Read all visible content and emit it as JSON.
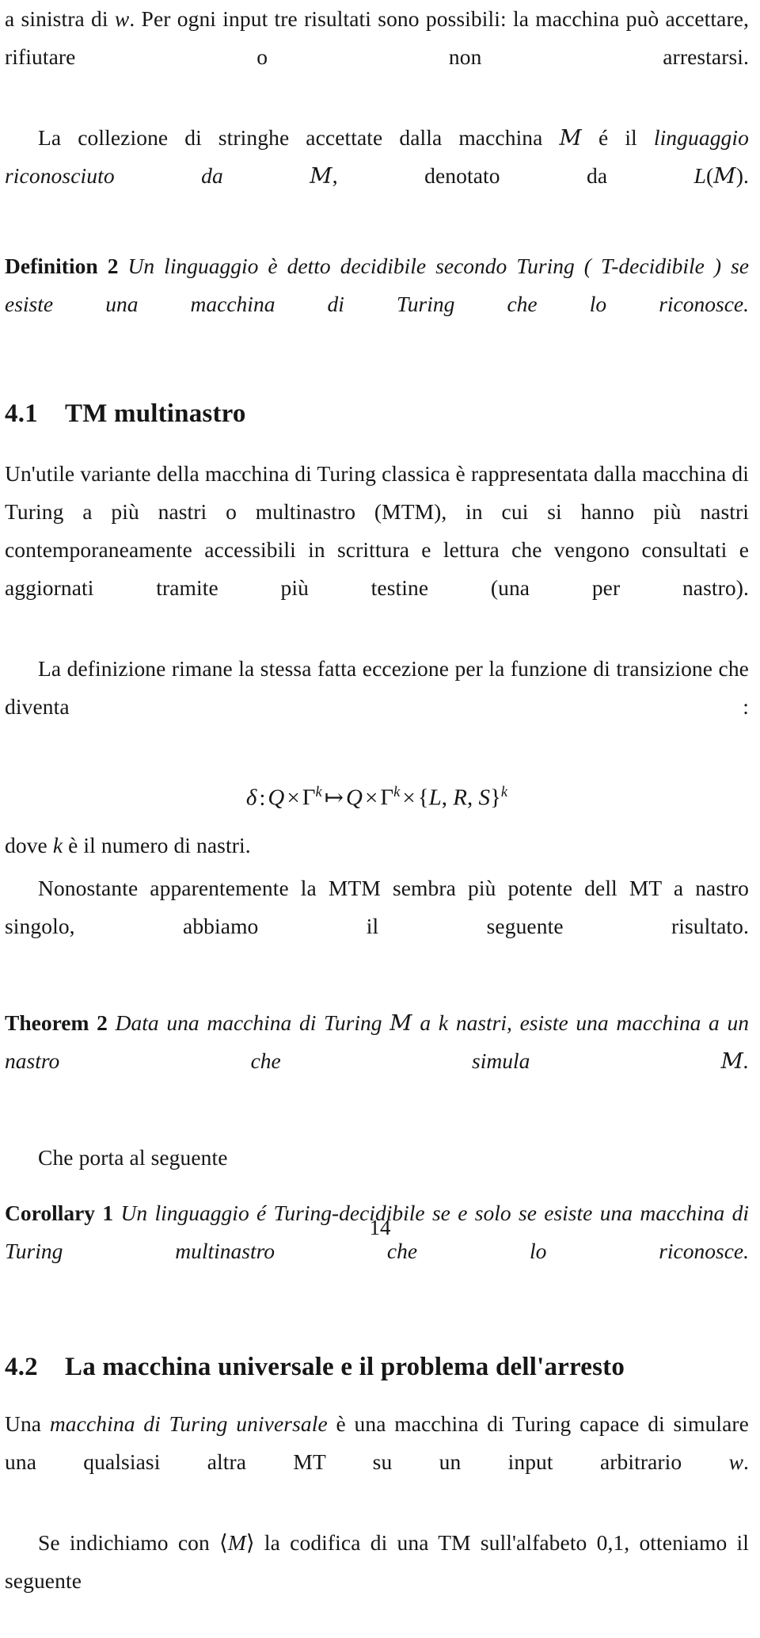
{
  "document": {
    "language": "it",
    "page_number": "14"
  },
  "blocks": {
    "para_results": {
      "t1": "a sinistra di ",
      "var_w": "w",
      "t2": ". Per ogni input tre risultati sono possibili: la macchina può accettare, rifiutare o non arrestarsi."
    },
    "para_language": {
      "t1": "La collezione di stringhe accettate dalla macchina ",
      "cal_M": "M",
      "t2": " é il ",
      "em1": "linguaggio riconosciuto da ",
      "cal_M2": "M",
      "t3": ", denotato da ",
      "var_L": "L",
      "t4": "(",
      "cal_M3": "M",
      "t5": ")."
    },
    "definition2": {
      "head": "Definition 2",
      "body": "Un linguaggio è detto decidibile secondo Turing ( T-decidibile ) se esiste una macchina di Turing che lo riconosce."
    },
    "section_41": {
      "number": "4.1",
      "title": "TM multinastro"
    },
    "para_mtm": {
      "text": "Un'utile variante della macchina di Turing classica è rappresentata dalla macchina di Turing a più nastri o multinastro (MTM), in cui si hanno più nastri contemporaneamente accessibili in scrittura e lettura che vengono consultati e aggiornati tramite più testine (una per nastro)."
    },
    "para_definizione": {
      "text": "La definizione rimane la stessa fatta eccezione per la funzione di transizione che diventa :"
    },
    "equation_delta": {
      "delta": "δ",
      "colon": ":",
      "Q1": "Q",
      "times1": "×",
      "Gamma1": "Γ",
      "exp1": "k",
      "mapsto": "↦",
      "Q2": "Q",
      "times2": "×",
      "Gamma2": "Γ",
      "exp2": "k",
      "times3": "×",
      "set_open": "{",
      "set_L": "L",
      "comma1": ",",
      "set_R": "R",
      "comma2": ",",
      "set_S": "S",
      "set_close": "}",
      "exp3": "k",
      "plain": "δ : Q × Γ^k ↦ Q × Γ^k × {L, R, S}^k"
    },
    "para_dove": {
      "t1": "dove ",
      "var_k": "k",
      "t2": " è il numero di nastri."
    },
    "para_nonostante": {
      "text": "Nonostante apparentemente la MTM sembra più potente dell MT a nastro singolo, abbiamo il seguente risultato."
    },
    "theorem2": {
      "head": "Theorem 2",
      "b1": "Data una macchina di Turing ",
      "cal_M": "M",
      "b2": " a ",
      "var_k": "k",
      "b3": " nastri, esiste una macchina a un nastro che simula ",
      "cal_M2": "M",
      "b4": "."
    },
    "para_cheporta": {
      "text": "Che porta al seguente"
    },
    "corollary1": {
      "head": "Corollary 1",
      "body": "Un linguaggio é Turing-decidibile se e solo se esiste una macchina di Turing multinastro che lo riconosce."
    },
    "section_42": {
      "number": "4.2",
      "title": "La macchina universale e il problema dell'arresto"
    },
    "para_universale": {
      "t1": "Una ",
      "em1": "macchina di Turing universale",
      "t2": " è una macchina di Turing capace di simulare una qualsiasi altra MT su un input arbitrario ",
      "var_w": "w",
      "t3": "."
    },
    "para_codifica": {
      "t1": "Se indichiamo con ",
      "angle_open": "⟨",
      "var_M": "M",
      "angle_close": "⟩",
      "t2": " la codifica di una TM sull'alfabeto 0,1, otteniamo il seguente"
    }
  },
  "footer": {
    "page_number": "14"
  }
}
